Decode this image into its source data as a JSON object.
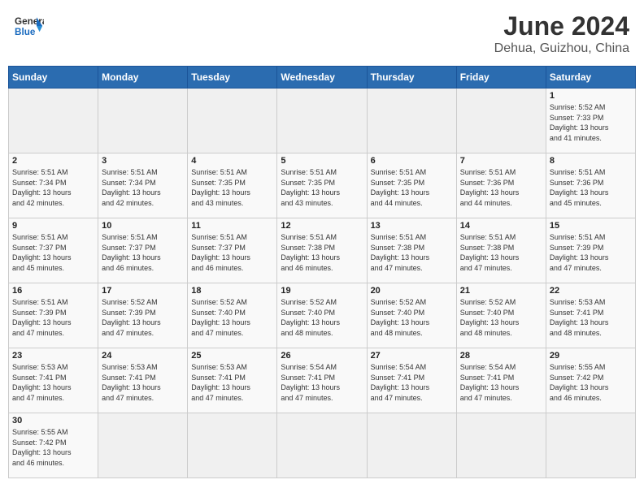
{
  "header": {
    "logo_general": "General",
    "logo_blue": "Blue",
    "month_title": "June 2024",
    "location": "Dehua, Guizhou, China"
  },
  "weekdays": [
    "Sunday",
    "Monday",
    "Tuesday",
    "Wednesday",
    "Thursday",
    "Friday",
    "Saturday"
  ],
  "weeks": [
    [
      {
        "day": "",
        "info": ""
      },
      {
        "day": "",
        "info": ""
      },
      {
        "day": "",
        "info": ""
      },
      {
        "day": "",
        "info": ""
      },
      {
        "day": "",
        "info": ""
      },
      {
        "day": "",
        "info": ""
      },
      {
        "day": "1",
        "info": "Sunrise: 5:52 AM\nSunset: 7:33 PM\nDaylight: 13 hours\nand 41 minutes."
      }
    ],
    [
      {
        "day": "2",
        "info": "Sunrise: 5:51 AM\nSunset: 7:34 PM\nDaylight: 13 hours\nand 42 minutes."
      },
      {
        "day": "3",
        "info": "Sunrise: 5:51 AM\nSunset: 7:34 PM\nDaylight: 13 hours\nand 42 minutes."
      },
      {
        "day": "4",
        "info": "Sunrise: 5:51 AM\nSunset: 7:35 PM\nDaylight: 13 hours\nand 43 minutes."
      },
      {
        "day": "5",
        "info": "Sunrise: 5:51 AM\nSunset: 7:35 PM\nDaylight: 13 hours\nand 43 minutes."
      },
      {
        "day": "6",
        "info": "Sunrise: 5:51 AM\nSunset: 7:35 PM\nDaylight: 13 hours\nand 44 minutes."
      },
      {
        "day": "7",
        "info": "Sunrise: 5:51 AM\nSunset: 7:36 PM\nDaylight: 13 hours\nand 44 minutes."
      },
      {
        "day": "8",
        "info": "Sunrise: 5:51 AM\nSunset: 7:36 PM\nDaylight: 13 hours\nand 45 minutes."
      }
    ],
    [
      {
        "day": "9",
        "info": "Sunrise: 5:51 AM\nSunset: 7:37 PM\nDaylight: 13 hours\nand 45 minutes."
      },
      {
        "day": "10",
        "info": "Sunrise: 5:51 AM\nSunset: 7:37 PM\nDaylight: 13 hours\nand 46 minutes."
      },
      {
        "day": "11",
        "info": "Sunrise: 5:51 AM\nSunset: 7:37 PM\nDaylight: 13 hours\nand 46 minutes."
      },
      {
        "day": "12",
        "info": "Sunrise: 5:51 AM\nSunset: 7:38 PM\nDaylight: 13 hours\nand 46 minutes."
      },
      {
        "day": "13",
        "info": "Sunrise: 5:51 AM\nSunset: 7:38 PM\nDaylight: 13 hours\nand 47 minutes."
      },
      {
        "day": "14",
        "info": "Sunrise: 5:51 AM\nSunset: 7:38 PM\nDaylight: 13 hours\nand 47 minutes."
      },
      {
        "day": "15",
        "info": "Sunrise: 5:51 AM\nSunset: 7:39 PM\nDaylight: 13 hours\nand 47 minutes."
      }
    ],
    [
      {
        "day": "16",
        "info": "Sunrise: 5:51 AM\nSunset: 7:39 PM\nDaylight: 13 hours\nand 47 minutes."
      },
      {
        "day": "17",
        "info": "Sunrise: 5:52 AM\nSunset: 7:39 PM\nDaylight: 13 hours\nand 47 minutes."
      },
      {
        "day": "18",
        "info": "Sunrise: 5:52 AM\nSunset: 7:40 PM\nDaylight: 13 hours\nand 47 minutes."
      },
      {
        "day": "19",
        "info": "Sunrise: 5:52 AM\nSunset: 7:40 PM\nDaylight: 13 hours\nand 48 minutes."
      },
      {
        "day": "20",
        "info": "Sunrise: 5:52 AM\nSunset: 7:40 PM\nDaylight: 13 hours\nand 48 minutes."
      },
      {
        "day": "21",
        "info": "Sunrise: 5:52 AM\nSunset: 7:40 PM\nDaylight: 13 hours\nand 48 minutes."
      },
      {
        "day": "22",
        "info": "Sunrise: 5:53 AM\nSunset: 7:41 PM\nDaylight: 13 hours\nand 48 minutes."
      }
    ],
    [
      {
        "day": "23",
        "info": "Sunrise: 5:53 AM\nSunset: 7:41 PM\nDaylight: 13 hours\nand 47 minutes."
      },
      {
        "day": "24",
        "info": "Sunrise: 5:53 AM\nSunset: 7:41 PM\nDaylight: 13 hours\nand 47 minutes."
      },
      {
        "day": "25",
        "info": "Sunrise: 5:53 AM\nSunset: 7:41 PM\nDaylight: 13 hours\nand 47 minutes."
      },
      {
        "day": "26",
        "info": "Sunrise: 5:54 AM\nSunset: 7:41 PM\nDaylight: 13 hours\nand 47 minutes."
      },
      {
        "day": "27",
        "info": "Sunrise: 5:54 AM\nSunset: 7:41 PM\nDaylight: 13 hours\nand 47 minutes."
      },
      {
        "day": "28",
        "info": "Sunrise: 5:54 AM\nSunset: 7:41 PM\nDaylight: 13 hours\nand 47 minutes."
      },
      {
        "day": "29",
        "info": "Sunrise: 5:55 AM\nSunset: 7:42 PM\nDaylight: 13 hours\nand 46 minutes."
      }
    ],
    [
      {
        "day": "30",
        "info": "Sunrise: 5:55 AM\nSunset: 7:42 PM\nDaylight: 13 hours\nand 46 minutes."
      },
      {
        "day": "",
        "info": ""
      },
      {
        "day": "",
        "info": ""
      },
      {
        "day": "",
        "info": ""
      },
      {
        "day": "",
        "info": ""
      },
      {
        "day": "",
        "info": ""
      },
      {
        "day": "",
        "info": ""
      }
    ]
  ]
}
